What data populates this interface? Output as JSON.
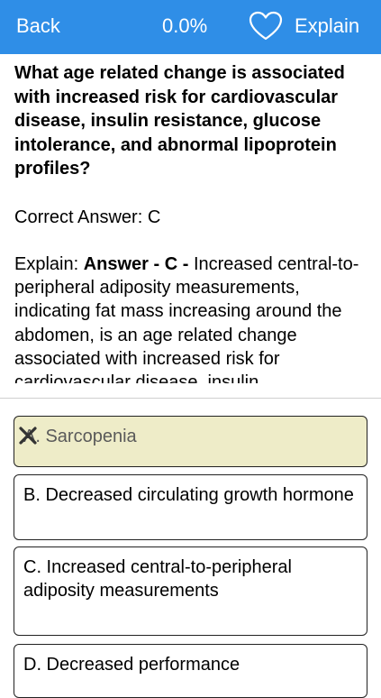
{
  "header": {
    "back_label": "Back",
    "progress": "0.0%",
    "explain_label": "Explain",
    "favorite_icon": "heart-outline-icon",
    "bar_color": "#2f8ee7"
  },
  "question": {
    "text": "What age related change is associated with increased risk for cardiovascular disease, insulin resistance, glucose intolerance, and abnormal lipoprotein profiles?"
  },
  "answer": {
    "correct_text": "Correct Answer: C"
  },
  "explanation": {
    "prefix": "Explain: ",
    "bold": "Answer - C - ",
    "body": "Increased central-to-peripheral adiposity measurements, indicating fat mass increasing around the abdomen, is an age related change associated with increased risk for cardiovascular disease, insulin"
  },
  "options": [
    {
      "label": "A. Sarcopenia",
      "state": "wrong",
      "mark_icon": "x-mark-icon",
      "highlight_color": "#eeecc8"
    },
    {
      "label": "B. Decreased circulating growth hormone"
    },
    {
      "label": "C. Increased central-to-peripheral adiposity measurements"
    },
    {
      "label": "D. Decreased performance"
    }
  ]
}
